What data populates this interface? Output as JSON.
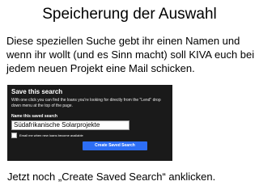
{
  "slide": {
    "title": "Speicherung der Auswahl",
    "body": "Diese speziellen Suche gebt ihr einen Namen und wenn ihr wollt (und es Sinn macht) soll KIVA euch bei jedem neuen Projekt eine Mail schicken.",
    "footer": "Jetzt noch „Create Saved Search“ anklicken."
  },
  "screenshot": {
    "heading": "Save this search",
    "description": "With one click you can find the loans you're looking for directly from the \"Lend\" drop down menu at the top of the page.",
    "name_label": "Name this saved search",
    "name_value": "Südafrikanische Solarprojekte",
    "email_label": "Email me when new loans become available",
    "create_button_label": "Create Saved Search"
  },
  "colors": {
    "dialog_background": "#1a1a1a",
    "button_blue": "#2d6ef5"
  }
}
